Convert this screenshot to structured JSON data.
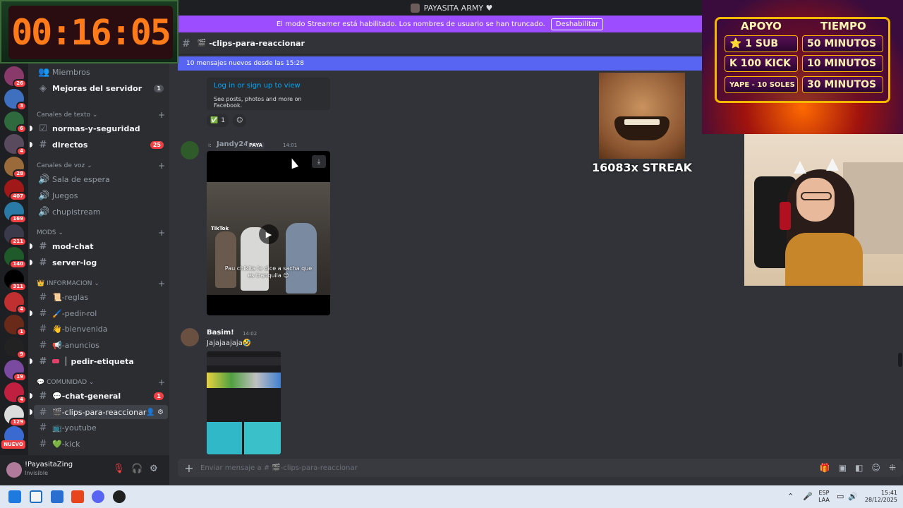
{
  "window": {
    "title": "PAYASITA ARMY ♥"
  },
  "streamer_mode": {
    "text": "El modo Streamer está habilitado. Los nombres de usuario se han truncado.",
    "button": "Deshabilitar"
  },
  "channel": {
    "name": "-clips-para-reaccionar",
    "icon": "clapper-icon",
    "new_messages": "10 mensajes nuevos desde las 15:28"
  },
  "server_rail": {
    "badges": [
      "26",
      "3",
      "6",
      "4",
      "28",
      "407",
      "169",
      "211",
      "140",
      "311",
      "4",
      "1",
      "9",
      "19",
      "4",
      "129"
    ],
    "new_label": "NUEVO"
  },
  "sidebar": {
    "top_items": [
      {
        "label": "Miembros",
        "icon": "members-icon"
      },
      {
        "label": "Mejoras del servidor",
        "icon": "boost-icon",
        "count": "1"
      }
    ],
    "categories": {
      "text": "Canales de texto",
      "voice": "Canales de voz",
      "mods": "MODS",
      "info": "INFORMACION",
      "community": "COMUNIDAD"
    },
    "text_channels": [
      {
        "label": "normas-y-seguridad"
      },
      {
        "label": "directos",
        "count": "25"
      }
    ],
    "voice_channels": [
      {
        "label": "Sala de espera"
      },
      {
        "label": "Juegos"
      },
      {
        "label": "chupistream"
      }
    ],
    "mods_channels": [
      {
        "label": "mod-chat"
      },
      {
        "label": "server-log"
      }
    ],
    "info_channels": [
      {
        "label": "📜-reglas"
      },
      {
        "label": "🖌️-pedir-rol"
      },
      {
        "label": "👋-bienvenida"
      },
      {
        "label": "📢-anuncios"
      },
      {
        "label": "│ pedir-etiqueta"
      }
    ],
    "community_channels": [
      {
        "label": "💬-chat-general",
        "count": "1"
      },
      {
        "label": "🎬-clips-para-reaccionar"
      },
      {
        "label": "📺-youtube"
      },
      {
        "label": "💚-kick"
      }
    ]
  },
  "user_panel": {
    "name": "!PayasitaZing",
    "status": "Invisible"
  },
  "messages": {
    "embed": {
      "link": "Log in or sign up to view",
      "desc": "See posts, photos and more on Facebook."
    },
    "reaction": {
      "emoji": "✅",
      "count": "1"
    },
    "msg1": {
      "prefix": "ı:",
      "user": "Jandy24",
      "tag": "PAYA",
      "time": "14:01",
      "tiktok": "TikTok",
      "caption": "Pau chikita le dice a sacha que es tranquila 😌"
    },
    "msg2": {
      "user": "Basim!",
      "time": "14:02",
      "text": "Jajajaajaja🤣"
    }
  },
  "composer": {
    "placeholder": "Enviar mensaje a # 🎬-clips-para-reaccionar"
  },
  "overlays": {
    "timer": "00:16:05",
    "support": {
      "col1": "APOYO",
      "col2": "TIEMPO",
      "rows": [
        {
          "left": "⭐ 1 SUB",
          "right": "50 MINUTOS"
        },
        {
          "left": "K 100 KICK",
          "right": "10 MINUTOS"
        },
        {
          "left": "YAPE - 10 SOLES",
          "right": "30 MINUTOS"
        }
      ]
    },
    "streak": "16083x STREAK"
  },
  "taskbar": {
    "lang": "ESP",
    "region": "LAA",
    "time": "15:41",
    "date": "28/12/2025"
  },
  "colors": {
    "accent": "#5865f2",
    "streamer": "#9b4dff",
    "danger": "#f23f43",
    "timer": "#ff7a18"
  }
}
